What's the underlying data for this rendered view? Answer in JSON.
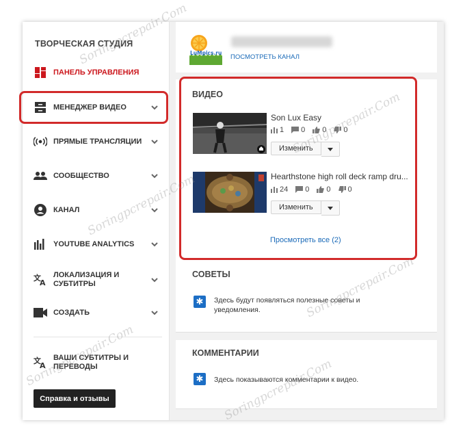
{
  "sidebar": {
    "title": "ТВОРЧЕСКАЯ СТУДИЯ",
    "items": [
      {
        "label": "ПАНЕЛЬ УПРАВЛЕНИЯ"
      },
      {
        "label": "МЕНЕДЖЕР ВИДЕО"
      },
      {
        "label": "ПРЯМЫЕ ТРАНСЛЯЦИИ"
      },
      {
        "label": "СООБЩЕСТВО"
      },
      {
        "label": "КАНАЛ"
      },
      {
        "label": "YOUTUBE ANALYTICS"
      },
      {
        "label": "ЛОКАЛИЗАЦИЯ И СУБТИТРЫ"
      },
      {
        "label": "СОЗДАТЬ"
      }
    ],
    "subtitles_item": "ВАШИ СУБТИТРЫ И ПЕРЕВОДЫ",
    "help_button": "Справка и отзывы"
  },
  "channel": {
    "logo_text": "LuMpics.ru",
    "view_channel": "ПОСМОТРЕТЬ КАНАЛ"
  },
  "videos": {
    "title": "ВИДЕО",
    "items": [
      {
        "title": "Son Lux Easy",
        "views": "1",
        "comments": "0",
        "likes": "0",
        "dislikes": "0",
        "edit": "Изменить"
      },
      {
        "title": "Hearthstone high roll deck ramp dru...",
        "views": "24",
        "comments": "0",
        "likes": "0",
        "dislikes": "0",
        "edit": "Изменить"
      }
    ],
    "view_all": "Просмотреть все (2)"
  },
  "tips": {
    "title": "СОВЕТЫ",
    "text": "Здесь будут появляться полезные советы и уведомления."
  },
  "comments": {
    "title": "КОММЕНТАРИИ",
    "text": "Здесь показываются комментарии к видео."
  },
  "watermark": "Soringpcrepair.Com",
  "colors": {
    "accent_red": "#cc181e",
    "link_blue": "#1a6ab8",
    "highlight_red": "#d22a2a"
  }
}
